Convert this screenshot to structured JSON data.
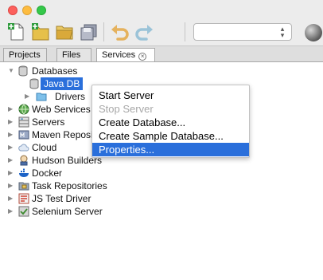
{
  "tabs": [
    {
      "label": "Projects"
    },
    {
      "label": "Files"
    },
    {
      "label": "Services"
    }
  ],
  "toolbar": {
    "icons": [
      "new-file-icon",
      "new-project-icon",
      "open-project-icon",
      "save-all-icon",
      "undo-icon",
      "redo-icon"
    ],
    "config_value": ""
  },
  "tree": {
    "databases": "Databases",
    "java_db": "Java DB",
    "drivers": "Drivers",
    "web_services": "Web Services",
    "servers": "Servers",
    "maven": "Maven Repositories",
    "cloud": "Cloud",
    "hudson": "Hudson Builders",
    "docker": "Docker",
    "task_repos": "Task Repositories",
    "js_test": "JS Test Driver",
    "selenium": "Selenium Server"
  },
  "context_menu": {
    "items": [
      {
        "label": "Start Server",
        "enabled": true
      },
      {
        "label": "Stop Server",
        "enabled": false
      },
      {
        "label": "Create Database...",
        "enabled": true
      },
      {
        "label": "Create Sample Database...",
        "enabled": true
      },
      {
        "label": "Properties...",
        "enabled": true,
        "highlighted": true
      }
    ]
  },
  "colors": {
    "selection": "#2a6fdb",
    "chrome": "#ececec"
  }
}
